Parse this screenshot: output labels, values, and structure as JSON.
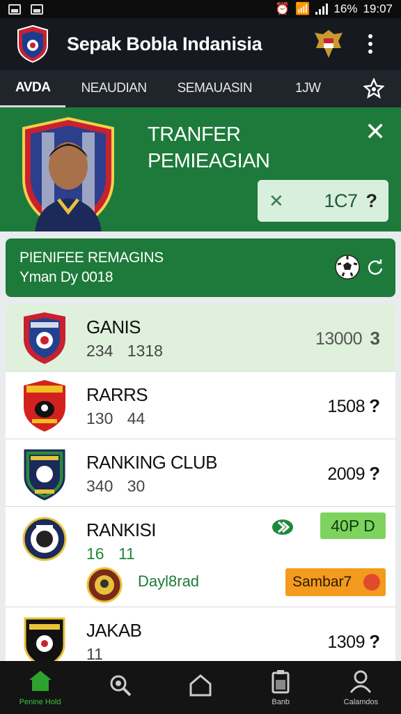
{
  "status_bar": {
    "battery": "16%",
    "time": "19:07"
  },
  "app": {
    "title": "Sepak Bobla Indanisia"
  },
  "tabs": [
    {
      "label": "AVDA",
      "active": true
    },
    {
      "label": "NEAUDIAN",
      "active": false
    },
    {
      "label": "SEMAUASIN",
      "active": false
    },
    {
      "label": "1JW",
      "active": false
    }
  ],
  "hero": {
    "title_line1": "TRANFER",
    "title_line2": "PEMIEAGIAN",
    "box_value": "1C7",
    "box_question": "?"
  },
  "banner": {
    "line1": "PIENIFEE REMAGINS",
    "line2": "Yman Dy 0018"
  },
  "list": [
    {
      "name": "GANIS",
      "sub": "234 1318",
      "value": "13000",
      "question": "3",
      "highlight": true
    },
    {
      "name": "RARRS",
      "sub": "130 44",
      "value": "1508",
      "question": "?"
    },
    {
      "name": "RANKING CLUB",
      "sub": "340 30",
      "value": "2009",
      "question": "?"
    },
    {
      "name": "RANKISI",
      "sub": "16 11",
      "tag_green": "40P D",
      "sub_label": "Dayl8rad",
      "tag_orange": "Sambar7"
    },
    {
      "name": "JAKAB",
      "sub": "11",
      "value": "1309",
      "question": "?"
    }
  ],
  "bottom_nav": [
    {
      "label": "Penine Hold",
      "active": true
    },
    {
      "label": "",
      "active": false
    },
    {
      "label": "",
      "active": false
    },
    {
      "label": "Banb",
      "active": false
    },
    {
      "label": "Calamdos",
      "active": false
    }
  ],
  "colors": {
    "primary_green": "#1d7a3a",
    "appbar": "#161a20",
    "highlight_row": "#dff1dc",
    "tag_green": "#7ed25e",
    "tag_orange": "#f39a1f"
  }
}
